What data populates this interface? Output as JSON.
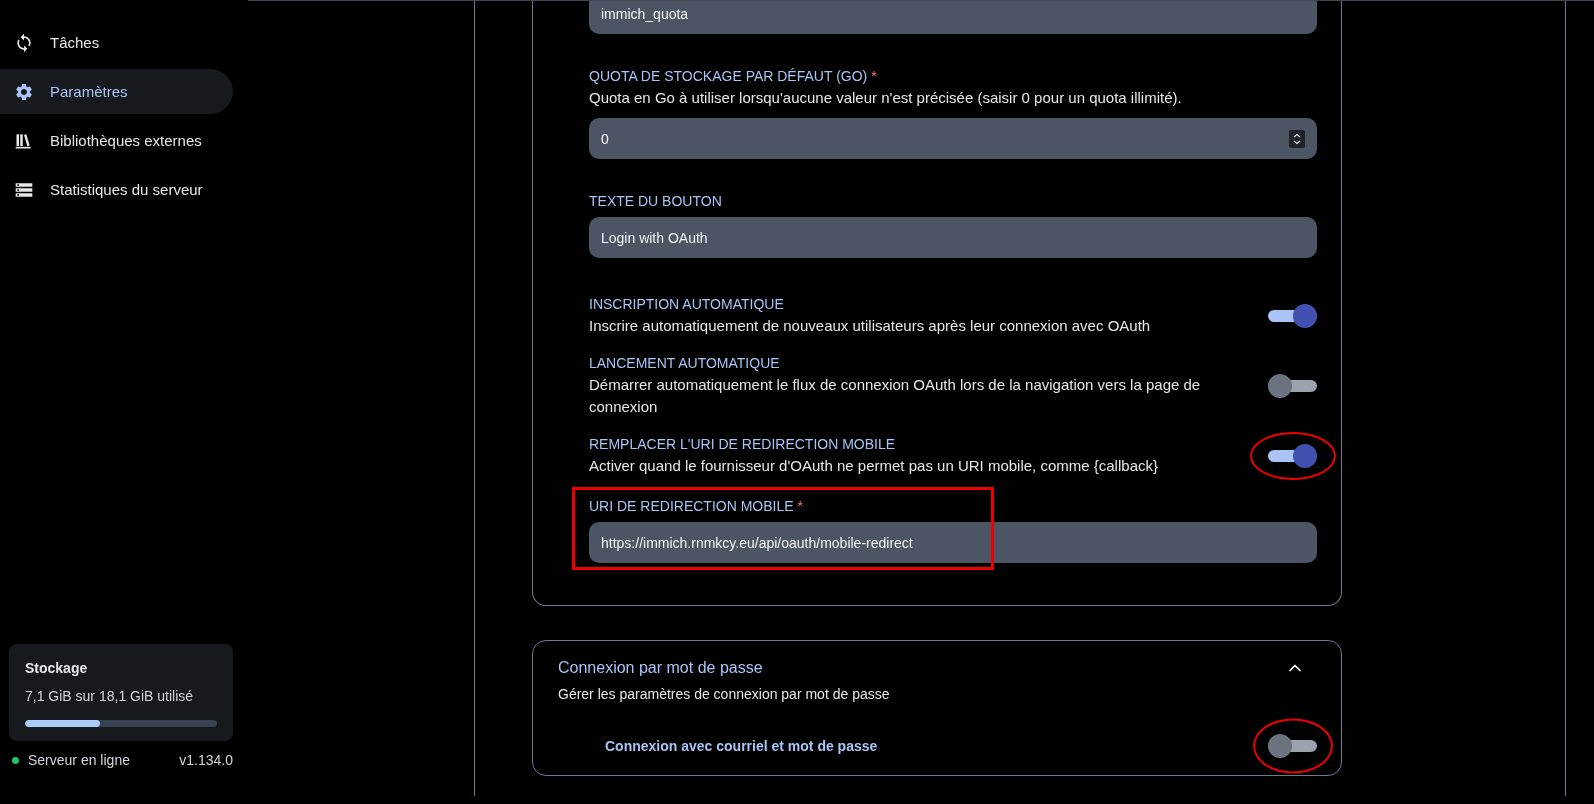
{
  "sidebar": {
    "items": [
      {
        "label": "Tâches",
        "selected": false
      },
      {
        "label": "Paramètres",
        "selected": true
      },
      {
        "label": "Bibliothèques externes",
        "selected": false
      },
      {
        "label": "Statistiques du serveur",
        "selected": false
      }
    ]
  },
  "storage": {
    "title": "Stockage",
    "usage": "7,1 GiB sur 18,1 GiB utilisé",
    "level": 0.39
  },
  "server": {
    "status": "Serveur en ligne",
    "online": true,
    "version": "v1.134.0"
  },
  "oauth_settings": [
    {
      "kind": "field",
      "value": "immich_quota"
    },
    {
      "kind": "number",
      "label": "QUOTA DE STOCKAGE PAR DÉFAUT (GO)",
      "required_mark": "*",
      "description": "Quota en Go à utiliser lorsqu'aucune valeur n'est précisée (saisir 0 pour un quota illimité).",
      "value": "0"
    },
    {
      "kind": "field",
      "label": "TEXTE DU BOUTON",
      "value": "Login with OAuth"
    },
    {
      "kind": "toggle",
      "label": "INSCRIPTION AUTOMATIQUE",
      "description": "Inscrire automatiquement de nouveaux utilisateurs après leur connexion avec OAuth",
      "on": true
    },
    {
      "kind": "toggle",
      "label": "LANCEMENT AUTOMATIQUE",
      "description": "Démarrer automatiquement le flux de connexion OAuth lors de la navigation vers la page de connexion",
      "on": false
    },
    {
      "kind": "toggle",
      "label": "REMPLACER L'URI DE REDIRECTION MOBILE",
      "description": "Activer quand le fournisseur d'OAuth ne permet pas un URI mobile, comme {callback}",
      "on": true,
      "marked": true
    },
    {
      "kind": "field",
      "label": "URI DE REDIRECTION MOBILE",
      "required_mark": "*",
      "value": "https://immich.rnmkcy.eu/api/oauth/mobile-redirect",
      "marked": true
    }
  ],
  "password_card": {
    "title": "Connexion par mot de passe",
    "description": "Gérer les paramètres de connexion par mot de passe",
    "expanded": true,
    "settings": [
      {
        "label": "Connexion avec courriel et mot de passe",
        "on": false,
        "marked": true
      }
    ]
  }
}
